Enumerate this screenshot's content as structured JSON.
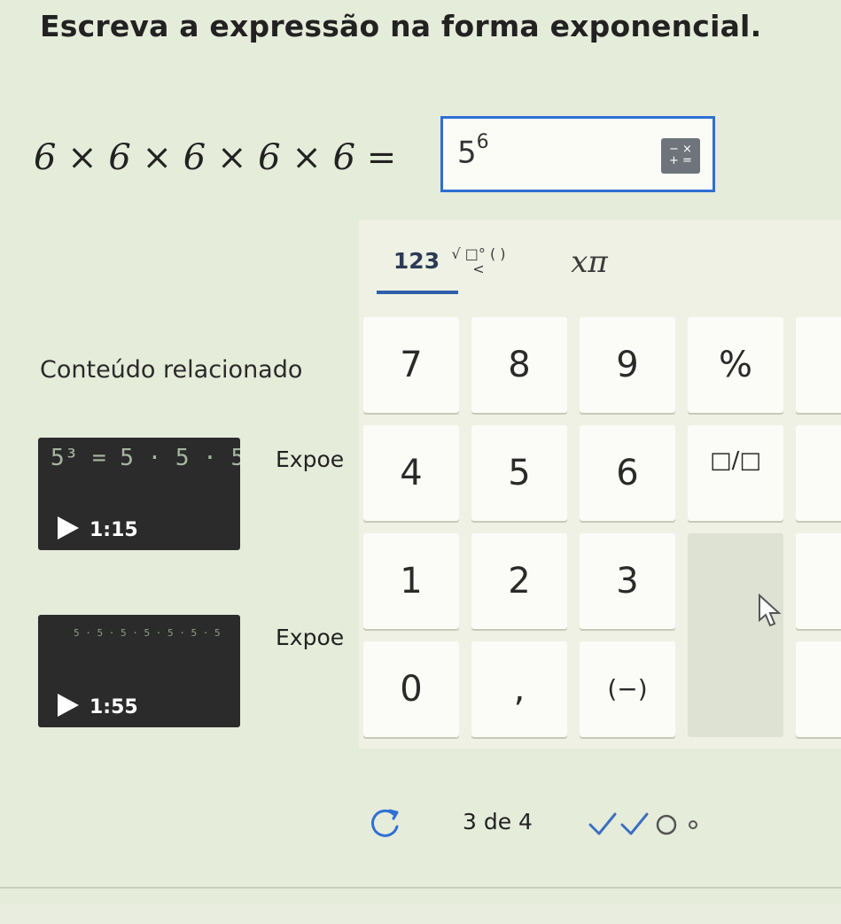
{
  "question": "Escreva a expressão na forma exponencial.",
  "expression": "6 × 6 × 6 × 6 × 6 =",
  "answer": {
    "base": "5",
    "exponent": "6"
  },
  "keypad_toggle_symbols": {
    "top": "− ×",
    "bottom": "+ ="
  },
  "keypad": {
    "tabs": [
      {
        "label": "123",
        "active": true
      },
      {
        "label": "√ □° ( ) <",
        "active": false
      },
      {
        "label": "xπ",
        "active": false
      }
    ],
    "keys": [
      "7",
      "8",
      "9",
      "%",
      "4",
      "5",
      "6",
      "□/□",
      "1",
      "2",
      "3",
      "0",
      ",",
      "(−)"
    ]
  },
  "related": {
    "title": "Conteúdo relacionado",
    "videos": [
      {
        "thumb_text": "5³ = 5 · 5 · 5",
        "duration": "1:15",
        "title": "Expoe"
      },
      {
        "thumb_text": "5 · 5 · 5 · 5 · 5 · 5 · 5",
        "duration": "1:55",
        "title": "Expoe"
      }
    ]
  },
  "progress": {
    "text": "3 de 4",
    "completed": 2,
    "total": 4
  },
  "colors": {
    "accent": "#2f6fd4",
    "background": "#e6ecda",
    "check": "#3c6fc2"
  }
}
